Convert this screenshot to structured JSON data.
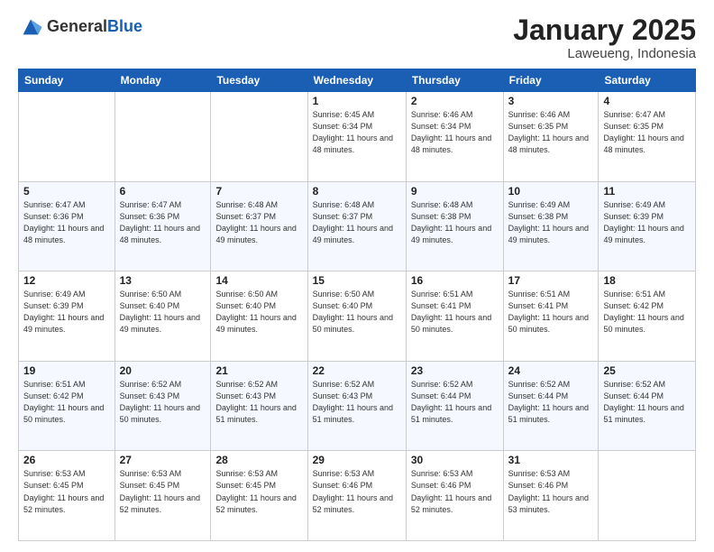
{
  "logo": {
    "general": "General",
    "blue": "Blue"
  },
  "header": {
    "month": "January 2025",
    "location": "Laweueng, Indonesia"
  },
  "weekdays": [
    "Sunday",
    "Monday",
    "Tuesday",
    "Wednesday",
    "Thursday",
    "Friday",
    "Saturday"
  ],
  "weeks": [
    [
      null,
      null,
      null,
      {
        "day": 1,
        "sunrise": "6:45 AM",
        "sunset": "6:34 PM",
        "daylight": "11 hours and 48 minutes."
      },
      {
        "day": 2,
        "sunrise": "6:46 AM",
        "sunset": "6:34 PM",
        "daylight": "11 hours and 48 minutes."
      },
      {
        "day": 3,
        "sunrise": "6:46 AM",
        "sunset": "6:35 PM",
        "daylight": "11 hours and 48 minutes."
      },
      {
        "day": 4,
        "sunrise": "6:47 AM",
        "sunset": "6:35 PM",
        "daylight": "11 hours and 48 minutes."
      }
    ],
    [
      {
        "day": 5,
        "sunrise": "6:47 AM",
        "sunset": "6:36 PM",
        "daylight": "11 hours and 48 minutes."
      },
      {
        "day": 6,
        "sunrise": "6:47 AM",
        "sunset": "6:36 PM",
        "daylight": "11 hours and 48 minutes."
      },
      {
        "day": 7,
        "sunrise": "6:48 AM",
        "sunset": "6:37 PM",
        "daylight": "11 hours and 49 minutes."
      },
      {
        "day": 8,
        "sunrise": "6:48 AM",
        "sunset": "6:37 PM",
        "daylight": "11 hours and 49 minutes."
      },
      {
        "day": 9,
        "sunrise": "6:48 AM",
        "sunset": "6:38 PM",
        "daylight": "11 hours and 49 minutes."
      },
      {
        "day": 10,
        "sunrise": "6:49 AM",
        "sunset": "6:38 PM",
        "daylight": "11 hours and 49 minutes."
      },
      {
        "day": 11,
        "sunrise": "6:49 AM",
        "sunset": "6:39 PM",
        "daylight": "11 hours and 49 minutes."
      }
    ],
    [
      {
        "day": 12,
        "sunrise": "6:49 AM",
        "sunset": "6:39 PM",
        "daylight": "11 hours and 49 minutes."
      },
      {
        "day": 13,
        "sunrise": "6:50 AM",
        "sunset": "6:40 PM",
        "daylight": "11 hours and 49 minutes."
      },
      {
        "day": 14,
        "sunrise": "6:50 AM",
        "sunset": "6:40 PM",
        "daylight": "11 hours and 49 minutes."
      },
      {
        "day": 15,
        "sunrise": "6:50 AM",
        "sunset": "6:40 PM",
        "daylight": "11 hours and 50 minutes."
      },
      {
        "day": 16,
        "sunrise": "6:51 AM",
        "sunset": "6:41 PM",
        "daylight": "11 hours and 50 minutes."
      },
      {
        "day": 17,
        "sunrise": "6:51 AM",
        "sunset": "6:41 PM",
        "daylight": "11 hours and 50 minutes."
      },
      {
        "day": 18,
        "sunrise": "6:51 AM",
        "sunset": "6:42 PM",
        "daylight": "11 hours and 50 minutes."
      }
    ],
    [
      {
        "day": 19,
        "sunrise": "6:51 AM",
        "sunset": "6:42 PM",
        "daylight": "11 hours and 50 minutes."
      },
      {
        "day": 20,
        "sunrise": "6:52 AM",
        "sunset": "6:43 PM",
        "daylight": "11 hours and 50 minutes."
      },
      {
        "day": 21,
        "sunrise": "6:52 AM",
        "sunset": "6:43 PM",
        "daylight": "11 hours and 51 minutes."
      },
      {
        "day": 22,
        "sunrise": "6:52 AM",
        "sunset": "6:43 PM",
        "daylight": "11 hours and 51 minutes."
      },
      {
        "day": 23,
        "sunrise": "6:52 AM",
        "sunset": "6:44 PM",
        "daylight": "11 hours and 51 minutes."
      },
      {
        "day": 24,
        "sunrise": "6:52 AM",
        "sunset": "6:44 PM",
        "daylight": "11 hours and 51 minutes."
      },
      {
        "day": 25,
        "sunrise": "6:52 AM",
        "sunset": "6:44 PM",
        "daylight": "11 hours and 51 minutes."
      }
    ],
    [
      {
        "day": 26,
        "sunrise": "6:53 AM",
        "sunset": "6:45 PM",
        "daylight": "11 hours and 52 minutes."
      },
      {
        "day": 27,
        "sunrise": "6:53 AM",
        "sunset": "6:45 PM",
        "daylight": "11 hours and 52 minutes."
      },
      {
        "day": 28,
        "sunrise": "6:53 AM",
        "sunset": "6:45 PM",
        "daylight": "11 hours and 52 minutes."
      },
      {
        "day": 29,
        "sunrise": "6:53 AM",
        "sunset": "6:46 PM",
        "daylight": "11 hours and 52 minutes."
      },
      {
        "day": 30,
        "sunrise": "6:53 AM",
        "sunset": "6:46 PM",
        "daylight": "11 hours and 52 minutes."
      },
      {
        "day": 31,
        "sunrise": "6:53 AM",
        "sunset": "6:46 PM",
        "daylight": "11 hours and 53 minutes."
      },
      null
    ]
  ],
  "labels": {
    "sunrise": "Sunrise:",
    "sunset": "Sunset:",
    "daylight": "Daylight:"
  }
}
